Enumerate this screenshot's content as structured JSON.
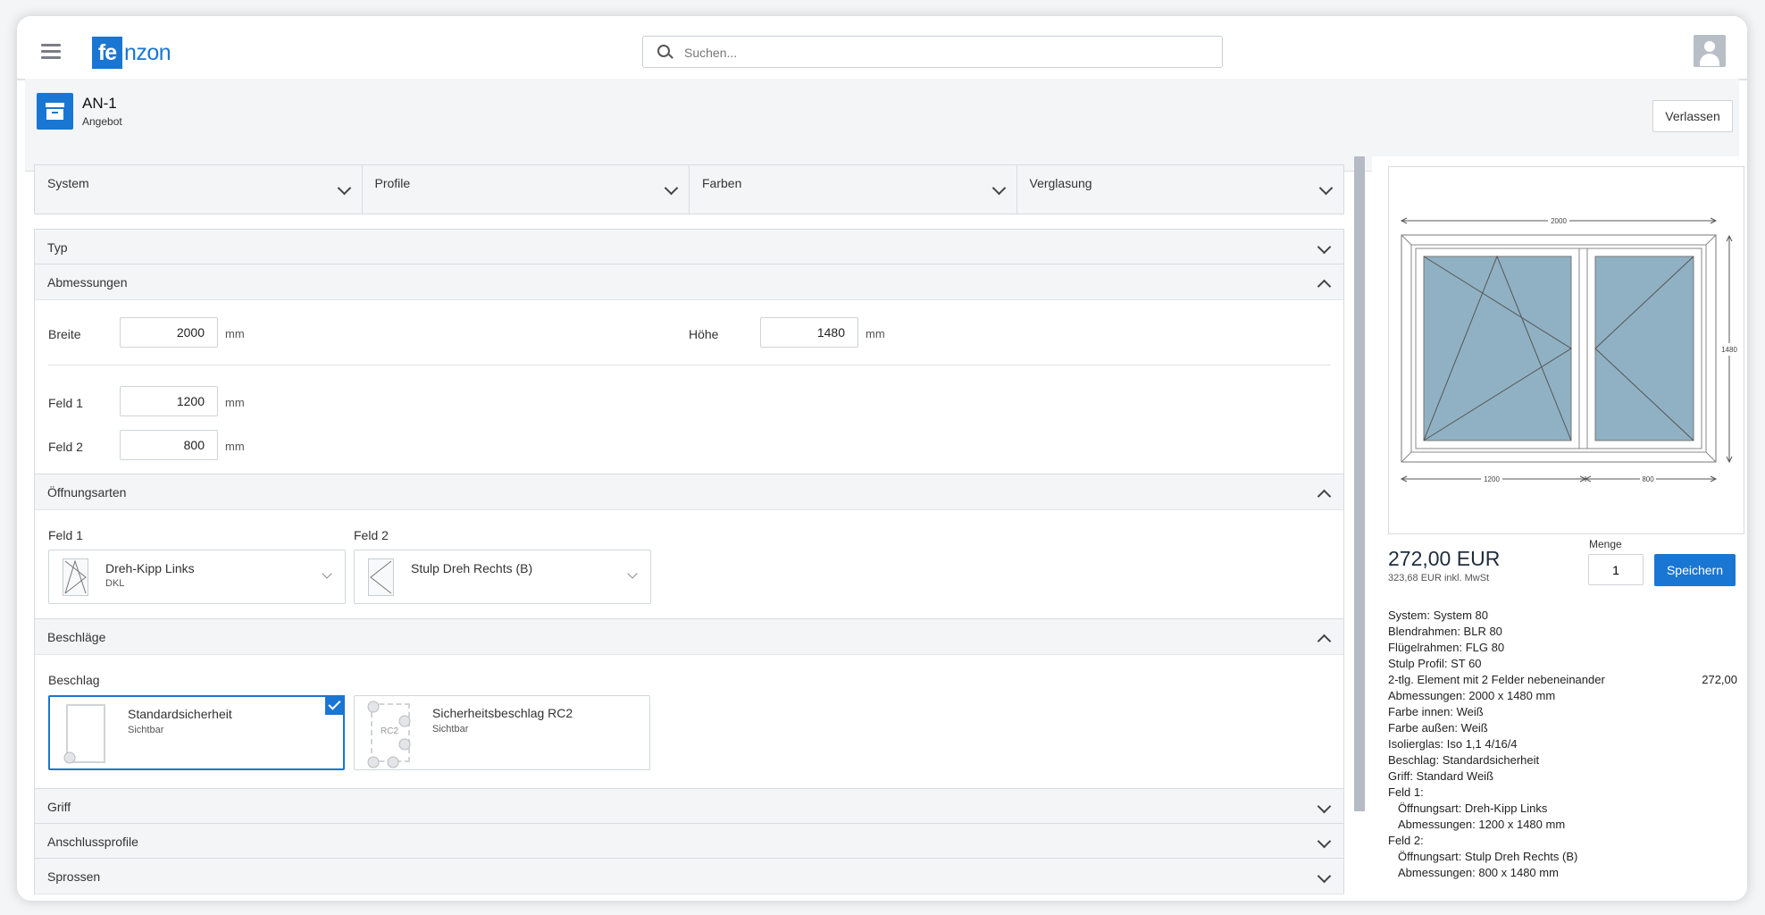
{
  "app": {
    "logo_box": "fe",
    "logo_rest": "nzon",
    "search_placeholder": "Suchen...",
    "icons": {
      "menu": "hamburger-icon",
      "search": "search-icon",
      "user": "user-avatar-icon",
      "doc": "archive-box-icon"
    }
  },
  "header": {
    "title": "AN-1",
    "subtitle": "Angebot",
    "leave_label": "Verlassen"
  },
  "tabs": [
    {
      "label": "System"
    },
    {
      "label": "Profile"
    },
    {
      "label": "Farben"
    },
    {
      "label": "Verglasung"
    }
  ],
  "sections": {
    "typ": "Typ",
    "abmessungen": "Abmessungen",
    "oeffnungsarten": "Öffnungsarten",
    "beschlaege": "Beschläge",
    "griff": "Griff",
    "anschlussprofile": "Anschlussprofile",
    "sprossen": "Sprossen"
  },
  "dimensions": {
    "breite_label": "Breite",
    "breite": "2000",
    "hoehe_label": "Höhe",
    "hoehe": "1480",
    "unit": "mm",
    "feld1_label": "Feld 1",
    "feld1": "1200",
    "feld2_label": "Feld 2",
    "feld2": "800"
  },
  "openings": {
    "feld1_label": "Feld 1",
    "feld1_name": "Dreh-Kipp Links",
    "feld1_code": "DKL",
    "feld2_label": "Feld 2",
    "feld2_name": "Stulp Dreh Rechts (B)"
  },
  "fittings": {
    "label": "Beschlag",
    "options": [
      {
        "name": "Standardsicherheit",
        "sub": "Sichtbar",
        "selected": true
      },
      {
        "name": "Sicherheitsbeschlag RC2",
        "sub": "Sichtbar",
        "selected": false,
        "badge": "RC2"
      }
    ]
  },
  "drawing": {
    "width_label": "2000",
    "height_label": "1480",
    "field1_label": "1200",
    "field2_label": "800",
    "glass_color": "#8fb1c3"
  },
  "pricing": {
    "price": "272,00 EUR",
    "price_gross": "323,68 EUR inkl. MwSt",
    "qty_label": "Menge",
    "qty": "1",
    "save_label": "Speichern"
  },
  "summary": [
    {
      "text": "System: System 80"
    },
    {
      "text": "Blendrahmen: BLR 80"
    },
    {
      "text": "Flügelrahmen: FLG 80"
    },
    {
      "text": "Stulp Profil: ST 60"
    },
    {
      "text": "2-tlg. Element mit 2 Felder nebeneinander",
      "amount": "272,00"
    },
    {
      "text": "Abmessungen: 2000 x 1480 mm"
    },
    {
      "text": "Farbe innen: Weiß"
    },
    {
      "text": "Farbe außen: Weiß"
    },
    {
      "text": "Isolierglas: Iso 1,1 4/16/4"
    },
    {
      "text": "Beschlag: Standardsicherheit"
    },
    {
      "text": "Griff: Standard Weiß"
    },
    {
      "text": "Feld 1:"
    },
    {
      "text": "Öffnungsart: Dreh-Kipp Links",
      "indent": true
    },
    {
      "text": "Abmessungen: 1200 x 1480 mm",
      "indent": true
    },
    {
      "text": "Feld 2:"
    },
    {
      "text": "Öffnungsart: Stulp Dreh Rechts (B)",
      "indent": true
    },
    {
      "text": "Abmessungen: 800 x 1480 mm",
      "indent": true
    }
  ],
  "colors": {
    "accent": "#1976d2",
    "background": "#f4f5f7",
    "border": "#d8dbdf",
    "scrollbar": "#b4bbc4"
  }
}
